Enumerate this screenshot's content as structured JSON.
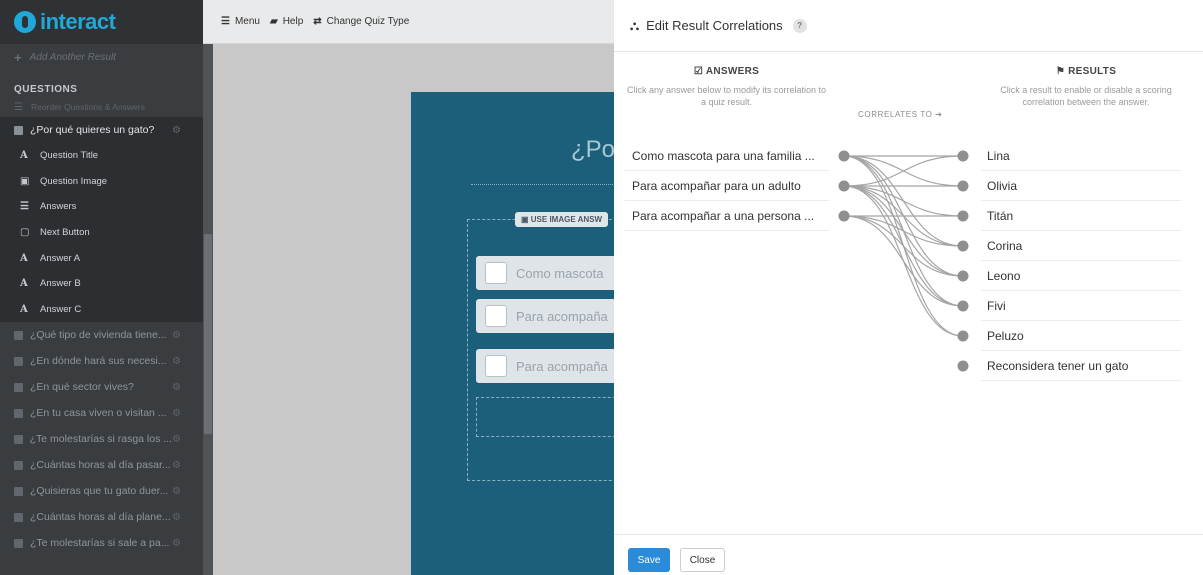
{
  "app": {
    "logo_text": "interact"
  },
  "sidebar": {
    "add_result": "Add Another Result",
    "questions_heading": "QUESTIONS",
    "reorder": "Reorder Questions & Answers",
    "active_question": "¿Por qué quieres un gato?",
    "sub_items": [
      {
        "icon": "text-icon",
        "glyph": "A",
        "label": "Question Title"
      },
      {
        "icon": "image-icon",
        "glyph": "▣",
        "label": "Question Image"
      },
      {
        "icon": "list-icon",
        "glyph": "☰",
        "label": "Answers"
      },
      {
        "icon": "button-icon",
        "glyph": "▢",
        "label": "Next Button"
      },
      {
        "icon": "text-icon",
        "glyph": "A",
        "label": "Answer A"
      },
      {
        "icon": "text-icon",
        "glyph": "A",
        "label": "Answer B"
      },
      {
        "icon": "text-icon",
        "glyph": "A",
        "label": "Answer C"
      }
    ],
    "questions": [
      "¿Qué tipo de vivienda tiene...",
      "¿En dónde hará sus necesi...",
      "¿En qué sector vives?",
      "¿En tu casa viven o visitan ...",
      "¿Te molestarías si rasga los ...",
      "¿Cuántas horas al día pasar...",
      "¿Quisieras que tu gato duer...",
      "¿Cuántas horas al día plane...",
      "¿Te molestarías si sale a pa..."
    ]
  },
  "toolbar": {
    "menu": "Menu",
    "help": "Help",
    "change_quiz": "Change Quiz Type"
  },
  "preview": {
    "title_fragment": "¿Po",
    "use_image": "USE IMAGE ANSW",
    "answers": [
      "Como mascota",
      "Para acompaña",
      "Para acompaña"
    ]
  },
  "modal": {
    "title": "Edit Result Correlations",
    "help": "?",
    "answers_title": "ANSWERS",
    "answers_sub": "Click any answer below to modify its correlation to a quiz result.",
    "correlates_to": "CORRELATES TO ➔",
    "results_title": "RESULTS",
    "results_sub": "Click a result to enable or disable a scoring correlation between the answer.",
    "answers": [
      "Como mascota para una familia ...",
      "Para acompañar para un adulto",
      "Para acompañar a una persona ..."
    ],
    "results": [
      "Lina",
      "Olivia",
      "Titán",
      "Corina",
      "Leono",
      "Fivi",
      "Peluzo",
      "Reconsidera tener un gato"
    ],
    "correlations": [
      [
        0,
        0
      ],
      [
        0,
        1
      ],
      [
        0,
        3
      ],
      [
        0,
        4
      ],
      [
        0,
        5
      ],
      [
        0,
        6
      ],
      [
        1,
        0
      ],
      [
        1,
        1
      ],
      [
        1,
        2
      ],
      [
        1,
        3
      ],
      [
        1,
        4
      ],
      [
        1,
        5
      ],
      [
        1,
        6
      ],
      [
        2,
        2
      ],
      [
        2,
        3
      ],
      [
        2,
        4
      ],
      [
        2,
        5
      ]
    ],
    "line_color": "#a5a5a5",
    "save": "Save",
    "close": "Close"
  },
  "colors": {
    "accent": "#20a8d8",
    "save_button": "#2b8bd8",
    "sidebar_bg": "#3a3d40",
    "preview_bg": "#1c5f7a"
  }
}
